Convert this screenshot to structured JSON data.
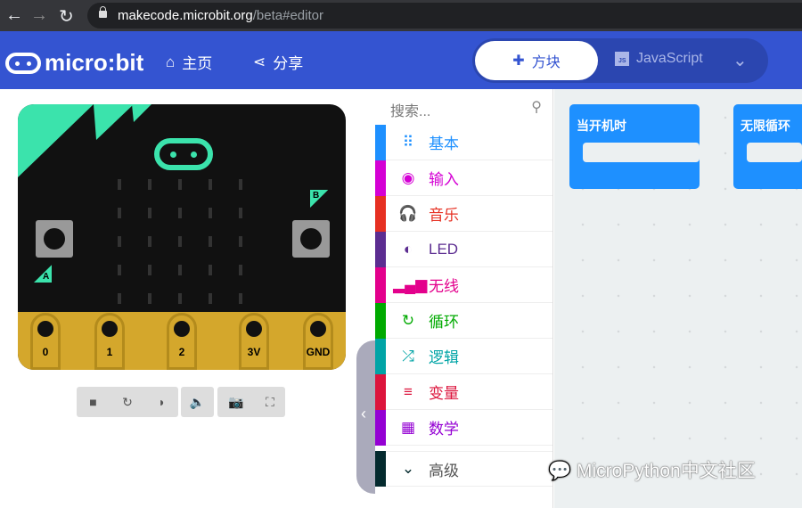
{
  "browser": {
    "url_host": "makecode.microbit.org",
    "url_path": "/beta#editor"
  },
  "header": {
    "logo": "micro:bit",
    "home": "主页",
    "share": "分享",
    "tab_blocks": "方块",
    "tab_js": "JavaScript",
    "js_icon": "JS"
  },
  "board": {
    "button_a": "A",
    "button_b": "B",
    "pins": [
      "0",
      "1",
      "2",
      "3V",
      "GND"
    ]
  },
  "toolbox": {
    "search_placeholder": "搜索...",
    "categories": [
      {
        "label": "基本",
        "color": "#1e90ff",
        "icon": "⠿"
      },
      {
        "label": "输入",
        "color": "#d400d4",
        "icon": "◉"
      },
      {
        "label": "音乐",
        "color": "#e63022",
        "icon": "🎧"
      },
      {
        "label": "LED",
        "color": "#5c2d91",
        "icon": "◐"
      },
      {
        "label": "无线",
        "color": "#e3008c",
        "icon": "▂▄▆"
      },
      {
        "label": "循环",
        "color": "#00aa00",
        "icon": "↻"
      },
      {
        "label": "逻辑",
        "color": "#00a4a6",
        "icon": "⤮"
      },
      {
        "label": "变量",
        "color": "#dc143c",
        "icon": "≡"
      },
      {
        "label": "数学",
        "color": "#9400d3",
        "icon": "▦"
      }
    ],
    "advanced": "高级"
  },
  "workspace": {
    "blocks": [
      "当开机时",
      "无限循环"
    ]
  },
  "watermark": "MicroPython中文社区"
}
